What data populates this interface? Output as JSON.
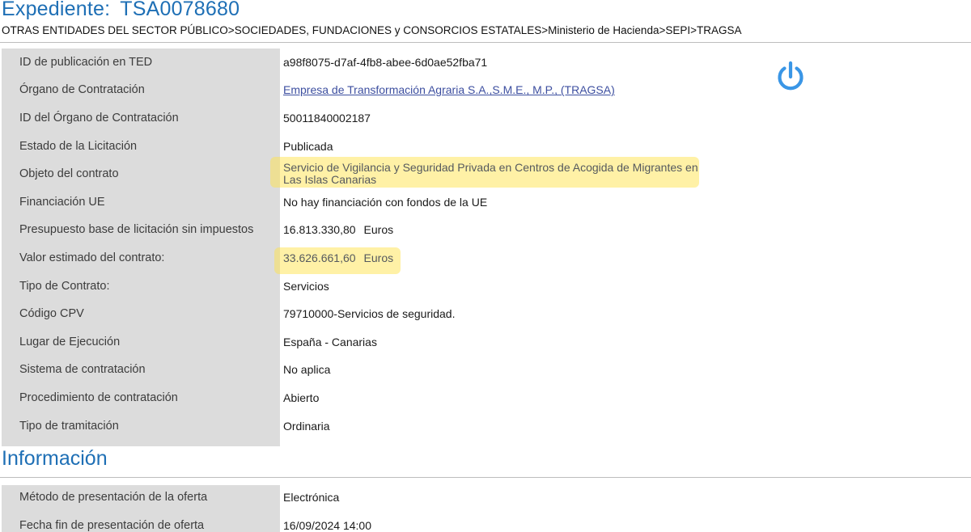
{
  "header": {
    "title_prefix": "Expediente:",
    "expediente_id": "TSA0078680",
    "breadcrumb": "OTRAS ENTIDADES DEL SECTOR PÚBLICO>SOCIEDADES, FUNDACIONES y CONSORCIOS ESTATALES>Ministerio de Hacienda>SEPI>TRAGSA"
  },
  "colors": {
    "title_blue": "#1e6fb5",
    "label_bg": "#dcdcdc",
    "link": "#3d4fa0",
    "power_icon": "#3a96e6",
    "highlight": "#ffe246"
  },
  "details": {
    "ted_id": {
      "label": "ID de publicación en TED",
      "value": "a98f8075-d7af-4fb8-abee-6d0ae52fba71"
    },
    "organo": {
      "label": "Órgano de Contratación",
      "value": "Empresa de Transformación Agraria S.A.,S.M.E., M.P., (TRAGSA)"
    },
    "organo_id": {
      "label": "ID del Órgano de Contratación",
      "value": "50011840002187"
    },
    "estado": {
      "label": "Estado de la Licitación",
      "value": "Publicada"
    },
    "objeto": {
      "label": "Objeto del contrato",
      "value": "Servicio de Vigilancia y Seguridad Privada en Centros de Acogida de Migrantes en Las Islas Canarias"
    },
    "financiacion": {
      "label": "Financiación UE",
      "value": "No hay financiación con fondos de la UE"
    },
    "presupuesto": {
      "label": "Presupuesto base de licitación sin impuestos",
      "value": "16.813.330,80",
      "unit": "Euros"
    },
    "valor_estimado": {
      "label": "Valor estimado del contrato:",
      "value": "33.626.661,60",
      "unit": "Euros"
    },
    "tipo_contrato": {
      "label": "Tipo de Contrato:",
      "value": "Servicios"
    },
    "cpv": {
      "label": "Código CPV",
      "value": "79710000-Servicios de seguridad."
    },
    "lugar": {
      "label": "Lugar de Ejecución",
      "value": "España - Canarias"
    },
    "sistema": {
      "label": "Sistema de contratación",
      "value": "No aplica"
    },
    "procedimiento": {
      "label": "Procedimiento de contratación",
      "value": "Abierto"
    },
    "tramitacion": {
      "label": "Tipo de tramitación",
      "value": "Ordinaria"
    }
  },
  "informacion": {
    "title": "Información",
    "metodo": {
      "label": "Método de presentación de la oferta",
      "value": "Electrónica"
    },
    "fecha_fin": {
      "label": "Fecha fin de presentación de oferta",
      "value": "16/09/2024 14:00"
    }
  },
  "icons": {
    "power": "power-icon"
  }
}
